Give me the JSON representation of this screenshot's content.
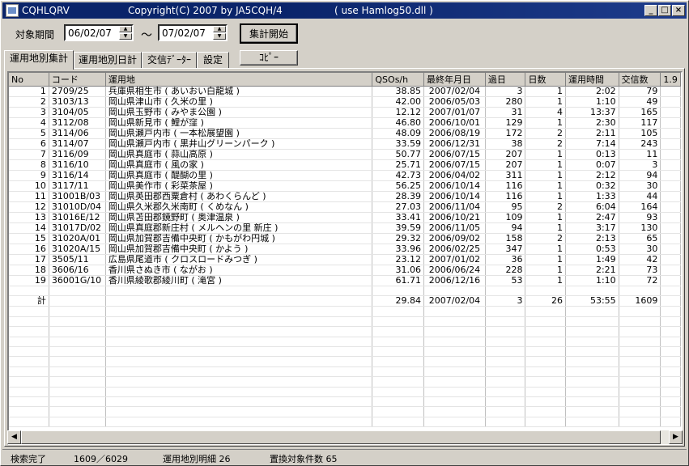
{
  "window": {
    "app_name": "CQHLQRV",
    "copyright": "Copyright(C) 2007  by  JA5CQH/4",
    "uses": "( use Hamlog50.dll )"
  },
  "controls": {
    "period_label": "対象期間",
    "date_from": "06/02/07",
    "tilde": "～",
    "date_to": "07/02/07",
    "start_button": "集計開始",
    "copy_button": "ｺﾋﾟｰ"
  },
  "tabs": [
    {
      "label": "運用地別集計"
    },
    {
      "label": "運用地別日計"
    },
    {
      "label": "交信ﾃﾞｰﾀｰ"
    },
    {
      "label": "設定"
    }
  ],
  "table": {
    "headers": [
      "No",
      "コード",
      "運用地",
      "QSOs/h",
      "最終年月日",
      "過日",
      "日数",
      "運用時間",
      "交信数",
      "1.9"
    ],
    "rows": [
      [
        "1",
        "2709/25",
        "兵庫県相生市 ( あいおい白龍城 )",
        "38.85",
        "2007/02/04",
        "3",
        "1",
        "2:02",
        "79"
      ],
      [
        "2",
        "3103/13",
        "岡山県津山市 ( 久米の里 )",
        "42.00",
        "2006/05/03",
        "280",
        "1",
        "1:10",
        "49"
      ],
      [
        "3",
        "3104/05",
        "岡山県玉野市 ( みやま公園 )",
        "12.12",
        "2007/01/07",
        "31",
        "4",
        "13:37",
        "165"
      ],
      [
        "4",
        "3112/08",
        "岡山県新見市 ( 鯉が窪 )",
        "46.80",
        "2006/10/01",
        "129",
        "1",
        "2:30",
        "117"
      ],
      [
        "5",
        "3114/06",
        "岡山県瀬戸内市 ( 一本松展望園 )",
        "48.09",
        "2006/08/19",
        "172",
        "2",
        "2:11",
        "105"
      ],
      [
        "6",
        "3114/07",
        "岡山県瀬戸内市 ( 黒井山グリーンパーク )",
        "33.59",
        "2006/12/31",
        "38",
        "2",
        "7:14",
        "243"
      ],
      [
        "7",
        "3116/09",
        "岡山県真庭市 ( 蒜山高原 )",
        "50.77",
        "2006/07/15",
        "207",
        "1",
        "0:13",
        "11"
      ],
      [
        "8",
        "3116/10",
        "岡山県真庭市 ( 風の家 )",
        "25.71",
        "2006/07/15",
        "207",
        "1",
        "0:07",
        "3"
      ],
      [
        "9",
        "3116/14",
        "岡山県真庭市 ( 醍醐の里 )",
        "42.73",
        "2006/04/02",
        "311",
        "1",
        "2:12",
        "94"
      ],
      [
        "10",
        "3117/11",
        "岡山県美作市 ( 彩菜茶屋 )",
        "56.25",
        "2006/10/14",
        "116",
        "1",
        "0:32",
        "30"
      ],
      [
        "11",
        "31001B/03",
        "岡山県英田郡西粟倉村 ( あわくらんど )",
        "28.39",
        "2006/10/14",
        "116",
        "1",
        "1:33",
        "44"
      ],
      [
        "12",
        "31010D/04",
        "岡山県久米郡久米南町 ( くめなん )",
        "27.03",
        "2006/11/04",
        "95",
        "2",
        "6:04",
        "164"
      ],
      [
        "13",
        "31016E/12",
        "岡山県苫田郡鏡野町 ( 奥津温泉 )",
        "33.41",
        "2006/10/21",
        "109",
        "1",
        "2:47",
        "93"
      ],
      [
        "14",
        "31017D/02",
        "岡山県真庭郡新庄村 ( メルヘンの里 新庄 )",
        "39.59",
        "2006/11/05",
        "94",
        "1",
        "3:17",
        "130"
      ],
      [
        "15",
        "31020A/01",
        "岡山県加賀郡吉備中央町 ( かもがわ円城 )",
        "29.32",
        "2006/09/02",
        "158",
        "2",
        "2:13",
        "65"
      ],
      [
        "16",
        "31020A/15",
        "岡山県加賀郡吉備中央町 ( かよう )",
        "33.96",
        "2006/02/25",
        "347",
        "1",
        "0:53",
        "30"
      ],
      [
        "17",
        "3505/11",
        "広島県尾道市 ( クロスロードみつぎ )",
        "23.12",
        "2007/01/02",
        "36",
        "1",
        "1:49",
        "42"
      ],
      [
        "18",
        "3606/16",
        "香川県さぬき市 ( ながお )",
        "31.06",
        "2006/06/24",
        "228",
        "1",
        "2:21",
        "73"
      ],
      [
        "19",
        "36001G/10",
        "香川県綾歌郡綾川町 ( 滝宮 )",
        "61.71",
        "2006/12/16",
        "53",
        "1",
        "1:10",
        "72"
      ]
    ],
    "total": [
      "計",
      "",
      "",
      "29.84",
      "2007/02/04",
      "3",
      "26",
      "53:55",
      "1609"
    ]
  },
  "status": {
    "search_done": "検索完了",
    "count": "1609／6029",
    "detail": "運用地別明細 26",
    "replace": "置換対象件数 65"
  }
}
